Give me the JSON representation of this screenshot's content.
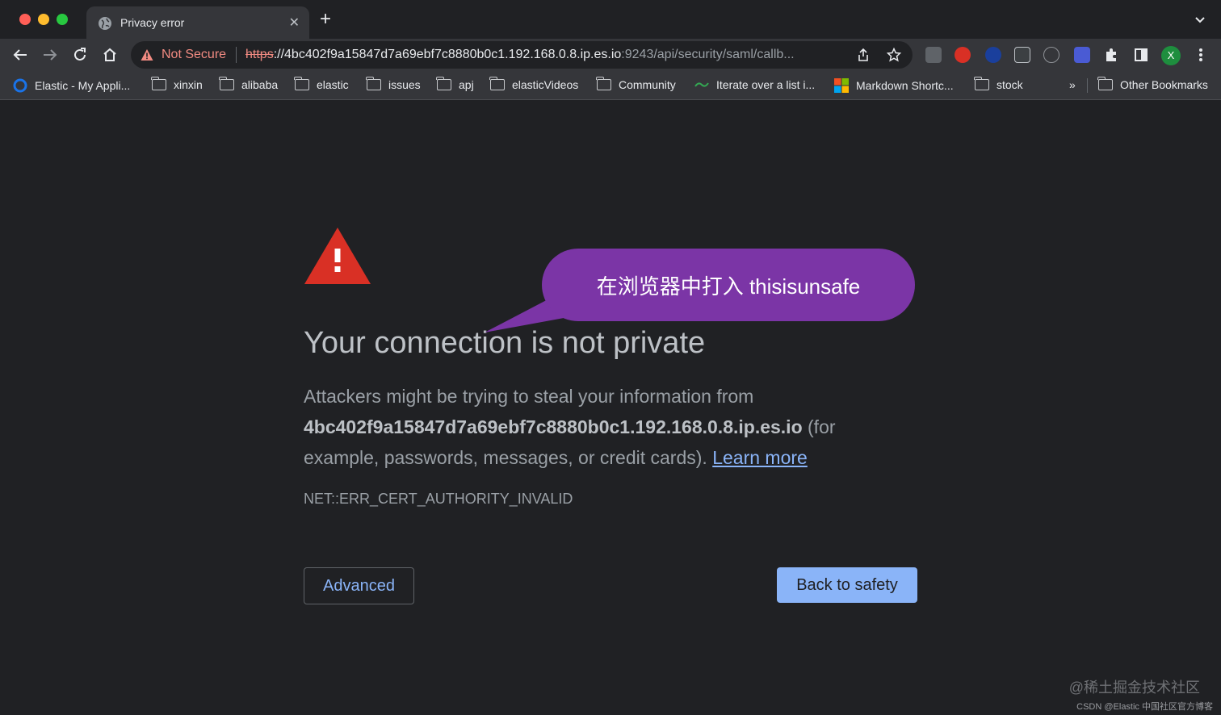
{
  "window": {
    "tab_title": "Privacy error",
    "tab_close": "✕",
    "new_tab": "+"
  },
  "address_bar": {
    "security_label": "Not Secure",
    "url_scheme": "https",
    "url_sep": "://",
    "url_host": "4bc402f9a15847d7a69ebf7c8880b0c1.192.168.0.8.ip.es.io",
    "url_path": ":9243/api/security/saml/callb..."
  },
  "profile": {
    "initial": "X"
  },
  "bookmarks": [
    {
      "label": "Elastic - My Appli...",
      "icon": "elastic-icon"
    },
    {
      "label": "xinxin",
      "icon": "folder-icon"
    },
    {
      "label": "alibaba",
      "icon": "folder-icon"
    },
    {
      "label": "elastic",
      "icon": "folder-icon"
    },
    {
      "label": "issues",
      "icon": "folder-icon"
    },
    {
      "label": "apj",
      "icon": "folder-icon"
    },
    {
      "label": "elasticVideos",
      "icon": "folder-icon"
    },
    {
      "label": "Community",
      "icon": "folder-icon"
    },
    {
      "label": "Iterate over a list i...",
      "icon": "site-icon"
    },
    {
      "label": "Markdown Shortc...",
      "icon": "microsoft-icon"
    },
    {
      "label": "stock",
      "icon": "folder-icon"
    }
  ],
  "bookmarks_overflow": "»",
  "other_bookmarks": "Other Bookmarks",
  "page": {
    "heading": "Your connection is not private",
    "body_prefix": "Attackers might be trying to steal your information from",
    "body_host": "4bc402f9a15847d7a69ebf7c8880b0c1.192.168.0.8.ip.es.io",
    "body_suffix": "(for example, passwords, messages, or credit cards).",
    "learn_more": "Learn more",
    "error_code": "NET::ERR_CERT_AUTHORITY_INVALID",
    "advanced_button": "Advanced",
    "back_button": "Back to safety"
  },
  "callout": {
    "text": "在浏览器中打入 thisisunsafe"
  },
  "watermarks": {
    "primary": "@稀土掘金技术社区",
    "secondary": "CSDN @Elastic 中国社区官方博客"
  },
  "colors": {
    "background": "#202124",
    "toolbar": "#35363a",
    "link": "#8ab4f8",
    "danger": "#f28b82",
    "callout": "#7b35a6",
    "warning_triangle": "#d93025"
  }
}
